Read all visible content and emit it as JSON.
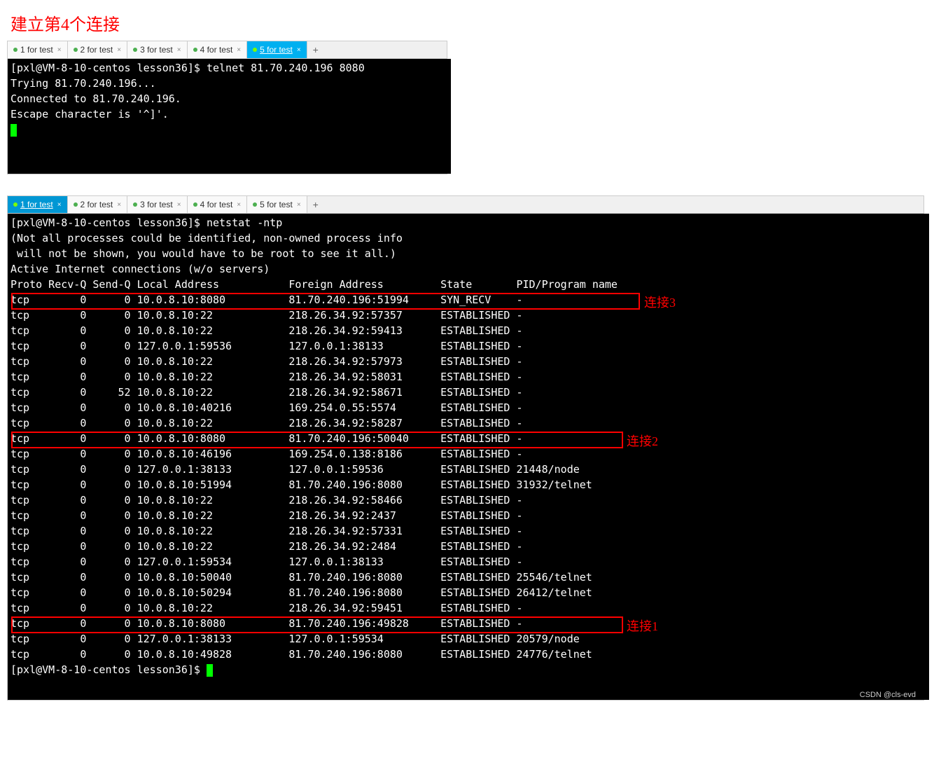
{
  "title": "建立第4个连接",
  "tabs1": [
    {
      "label": "1 for test",
      "active": false
    },
    {
      "label": "2 for test",
      "active": false
    },
    {
      "label": "3 for test",
      "active": false
    },
    {
      "label": "4 for test",
      "active": false
    },
    {
      "label": "5 for test",
      "active": true
    }
  ],
  "terminal1_lines": [
    "[pxl@VM-8-10-centos lesson36]$ telnet 81.70.240.196 8080",
    "Trying 81.70.240.196...",
    "Connected to 81.70.240.196.",
    "Escape character is '^]'."
  ],
  "tabs2": [
    {
      "label": "1 for test",
      "active": true
    },
    {
      "label": "2 for test",
      "active": false
    },
    {
      "label": "3 for test",
      "active": false
    },
    {
      "label": "4 for test",
      "active": false
    },
    {
      "label": "5 for test",
      "active": false
    }
  ],
  "terminal2_header": [
    "[pxl@VM-8-10-centos lesson36]$ netstat -ntp",
    "(Not all processes could be identified, non-owned process info",
    " will not be shown, you would have to be root to see it all.)",
    "Active Internet connections (w/o servers)"
  ],
  "netstat_header": "Proto Recv-Q Send-Q Local Address           Foreign Address         State       PID/Program name",
  "netstat_rows": [
    "tcp        0      0 10.0.8.10:8080          81.70.240.196:51994     SYN_RECV    -",
    "tcp        0      0 10.0.8.10:22            218.26.34.92:57357      ESTABLISHED -",
    "tcp        0      0 10.0.8.10:22            218.26.34.92:59413      ESTABLISHED -",
    "tcp        0      0 127.0.0.1:59536         127.0.0.1:38133         ESTABLISHED -",
    "tcp        0      0 10.0.8.10:22            218.26.34.92:57973      ESTABLISHED -",
    "tcp        0      0 10.0.8.10:22            218.26.34.92:58031      ESTABLISHED -",
    "tcp        0     52 10.0.8.10:22            218.26.34.92:58671      ESTABLISHED -",
    "tcp        0      0 10.0.8.10:40216         169.254.0.55:5574       ESTABLISHED -",
    "tcp        0      0 10.0.8.10:22            218.26.34.92:58287      ESTABLISHED -",
    "tcp        0      0 10.0.8.10:8080          81.70.240.196:50040     ESTABLISHED -",
    "tcp        0      0 10.0.8.10:46196         169.254.0.138:8186      ESTABLISHED -",
    "tcp        0      0 127.0.0.1:38133         127.0.0.1:59536         ESTABLISHED 21448/node",
    "tcp        0      0 10.0.8.10:51994         81.70.240.196:8080      ESTABLISHED 31932/telnet",
    "tcp        0      0 10.0.8.10:22            218.26.34.92:58466      ESTABLISHED -",
    "tcp        0      0 10.0.8.10:22            218.26.34.92:2437       ESTABLISHED -",
    "tcp        0      0 10.0.8.10:22            218.26.34.92:57331      ESTABLISHED -",
    "tcp        0      0 10.0.8.10:22            218.26.34.92:2484       ESTABLISHED -",
    "tcp        0      0 127.0.0.1:59534         127.0.0.1:38133         ESTABLISHED -",
    "tcp        0      0 10.0.8.10:50040         81.70.240.196:8080      ESTABLISHED 25546/telnet",
    "tcp        0      0 10.0.8.10:50294         81.70.240.196:8080      ESTABLISHED 26412/telnet",
    "tcp        0      0 10.0.8.10:22            218.26.34.92:59451      ESTABLISHED -",
    "tcp        0      0 10.0.8.10:8080          81.70.240.196:49828     ESTABLISHED -",
    "tcp        0      0 127.0.0.1:38133         127.0.0.1:59534         ESTABLISHED 20579/node",
    "tcp        0      0 10.0.8.10:49828         81.70.240.196:8080      ESTABLISHED 24776/telnet"
  ],
  "terminal2_prompt_end": "[pxl@VM-8-10-centos lesson36]$ ",
  "annotations": {
    "conn1": "连接1",
    "conn2": "连接2",
    "conn3": "连接3"
  },
  "add_tab": "+",
  "close_x": "×",
  "watermark": "CSDN @cls-evd"
}
